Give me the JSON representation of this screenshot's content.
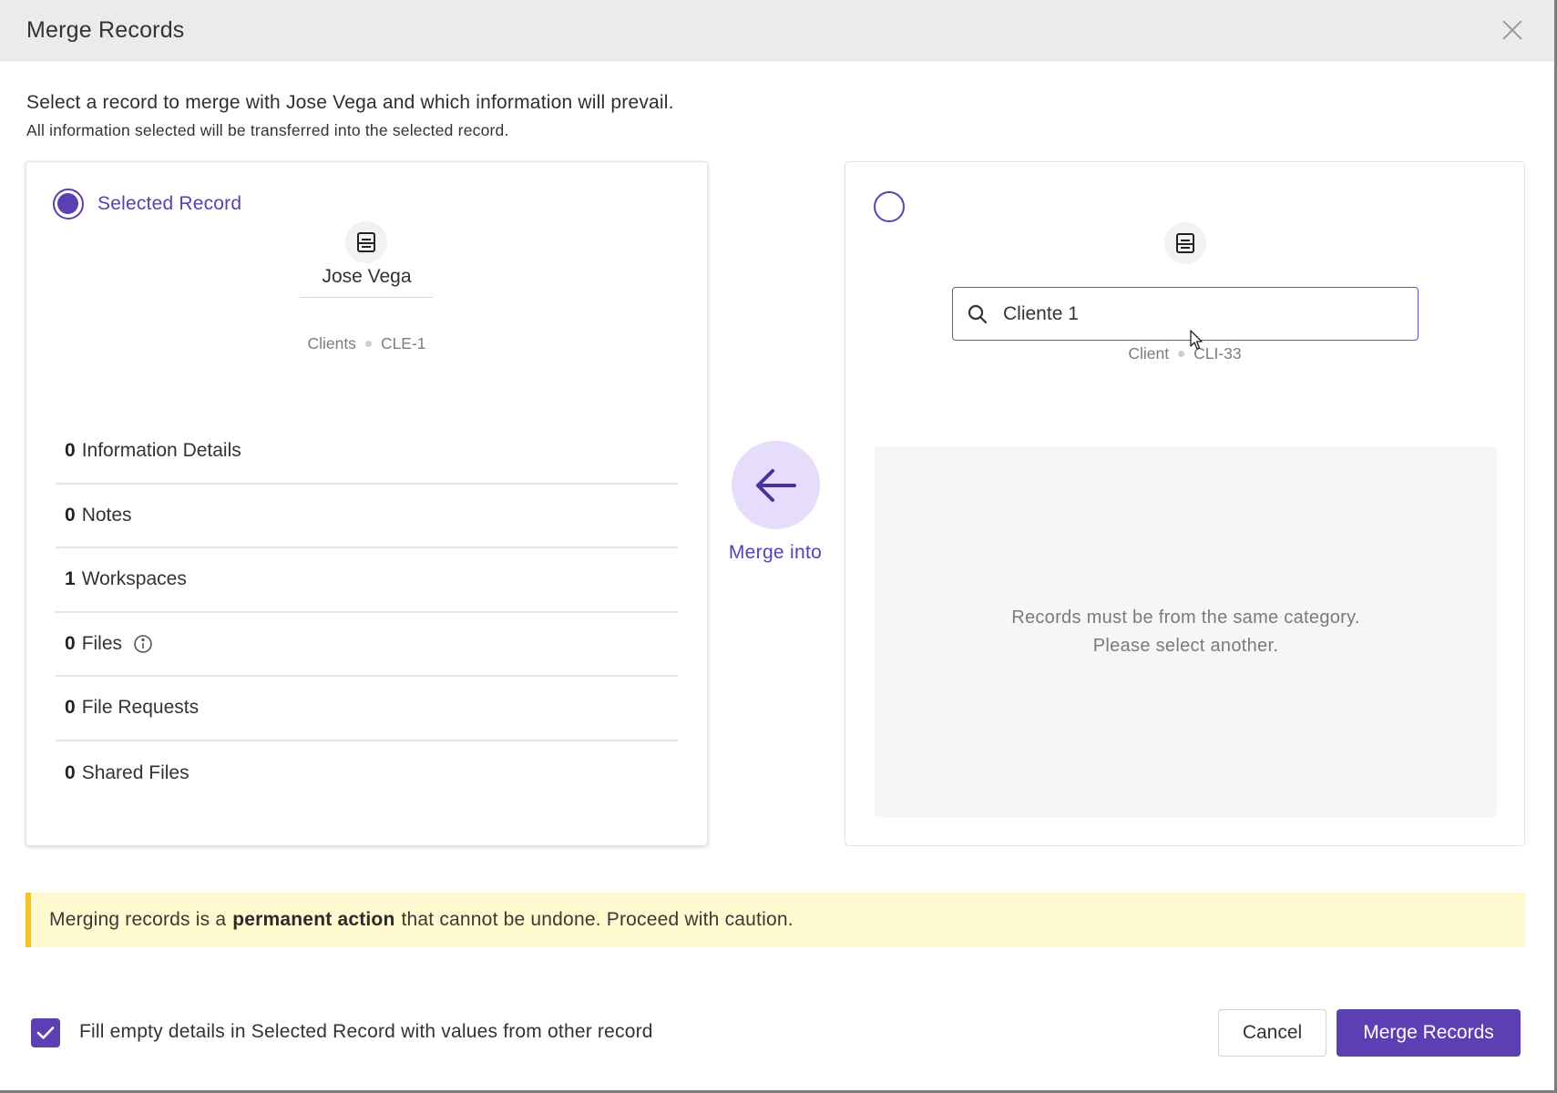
{
  "dialog": {
    "title": "Merge Records"
  },
  "intro": {
    "main": "Select a record to merge with Jose Vega and which information will prevail.",
    "sub": "All information selected will be transferred into the selected record."
  },
  "left_panel": {
    "radio_label": "Selected Record",
    "radio_checked": true,
    "icon": "record-icon",
    "record_name": "Jose Vega",
    "category": "Clients",
    "record_id": "CLE-1",
    "counts": [
      {
        "num": "0",
        "label": "Information Details"
      },
      {
        "num": "0",
        "label": "Notes"
      },
      {
        "num": "1",
        "label": "Workspaces"
      },
      {
        "num": "0",
        "label": "Files",
        "has_info_icon": true
      },
      {
        "num": "0",
        "label": "File Requests"
      },
      {
        "num": "0",
        "label": "Shared Files"
      }
    ]
  },
  "merge_into": {
    "icon": "arrow-left-icon",
    "label": "Merge into"
  },
  "right_panel": {
    "radio_checked": false,
    "icon": "record-icon",
    "search": {
      "value": "Cliente 1",
      "icon": "search-icon"
    },
    "category": "Client",
    "record_id": "CLI-33",
    "empty_message": {
      "line1": "Records must be from the same category.",
      "line2": "Please select another."
    }
  },
  "warning": {
    "prefix": "Merging records is a",
    "bold": "permanent action",
    "suffix": "that cannot be undone. Proceed with caution.",
    "accent_color": "#f6c324"
  },
  "footer": {
    "checkbox_checked": true,
    "checkbox_label": "Fill empty details in Selected Record with values from other record",
    "cancel_label": "Cancel",
    "merge_label": "Merge Records"
  },
  "colors": {
    "primary": "#5b3fb3",
    "merge_circle_bg": "#e6dcfb",
    "warning_bg": "#fef9cf"
  }
}
